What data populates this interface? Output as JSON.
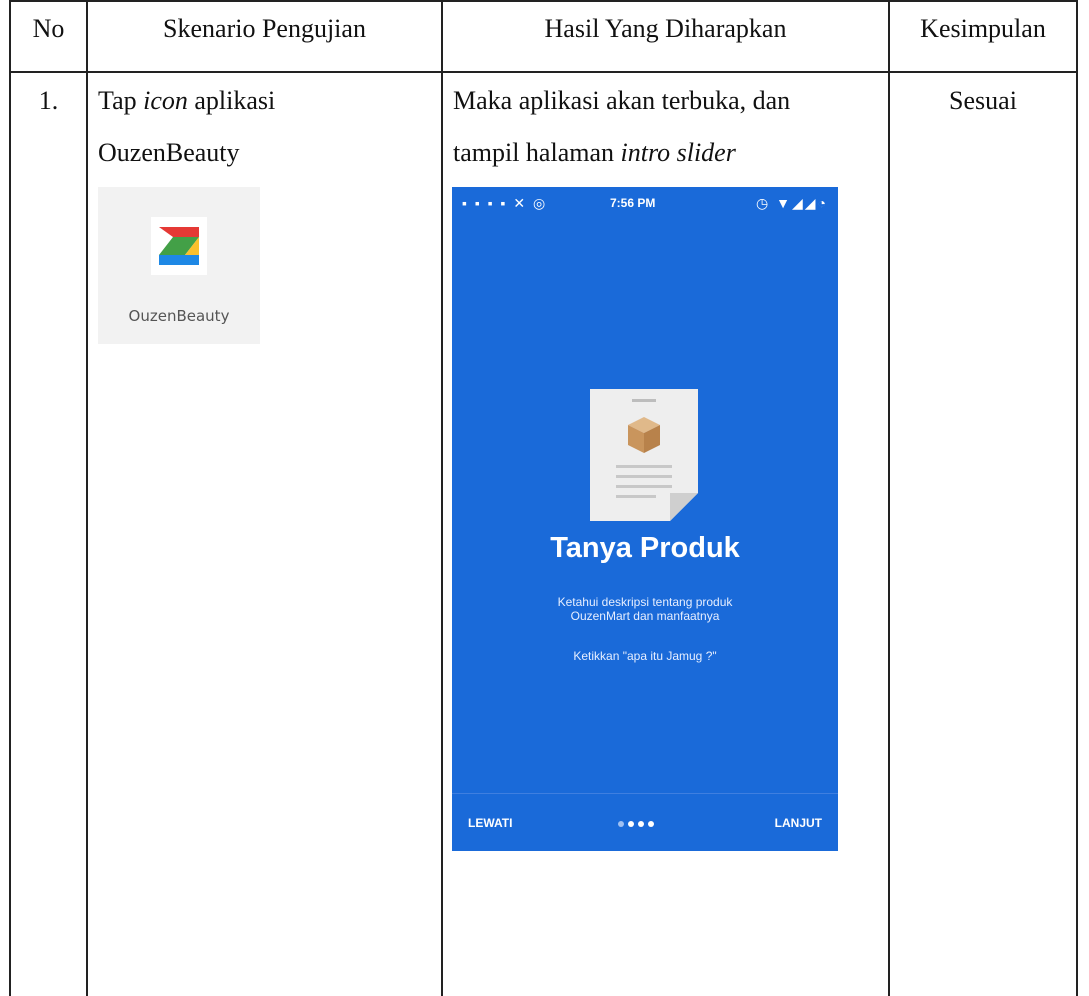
{
  "table": {
    "headers": [
      "No",
      "Skenario Pengujian",
      "Hasil Yang Diharapkan",
      "Kesimpulan"
    ],
    "rows": [
      {
        "no": "1.",
        "scenario_pre": "Tap",
        "scenario_em": "icon",
        "scenario_post": "aplikasi",
        "scenario_line2": "OuzenBeauty",
        "expected_line1": "Maka aplikasi akan terbuka, dan",
        "expected_line2_pre": "tampil halaman",
        "expected_line2_em": "intro slider",
        "conclusion": "Sesuai"
      }
    ]
  },
  "app_icon": {
    "label": "OuzenBeauty",
    "icon": "z-logo-icon"
  },
  "phone": {
    "status_time": "7:56 PM",
    "title": "Tanya Produk",
    "desc_line1": "Ketahui deskripsi tentang produk",
    "desc_line2": "OuzenMart dan manfaatnya",
    "hint": "Ketikkan \"apa itu Jamug ?\"",
    "skip_label": "LEWATI",
    "next_label": "LANJUT",
    "page_count": 4,
    "active_page": 1,
    "bg_color": "#1a6ad9"
  }
}
